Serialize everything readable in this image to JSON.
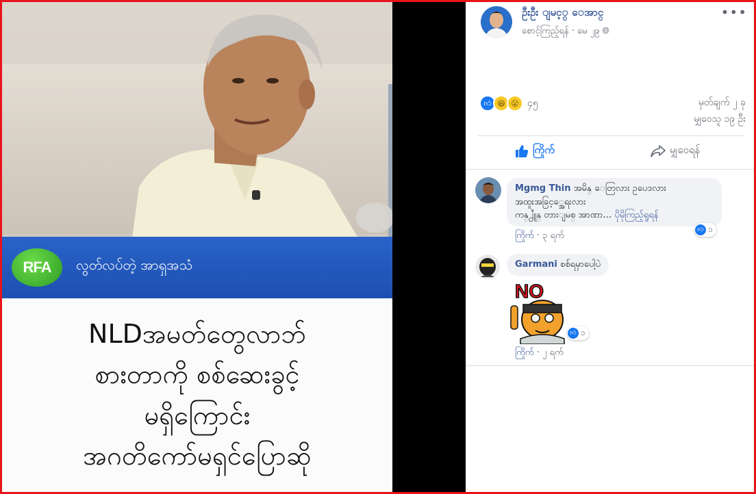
{
  "post_image": {
    "logo_text": "RFA",
    "banner_subtitle": "လွတ်လပ်တဲ့ အာရှအသံ",
    "caption_lines": [
      "NLDအမတ်တွေလာဘ်",
      "စားတာကို စစ်ဆေးခွင့်",
      "မရှိကြောင်း",
      "အဂတိကော်မရှင်ပြောဆို"
    ]
  },
  "post": {
    "author": "ဦးဦး ျမင့္ ေအာင္",
    "visibility_label": "စောင့်ကြည့်ရန်",
    "time": "မေ ၂၉",
    "more_label": "•••"
  },
  "reactions": {
    "count": "၄၅",
    "comments_label": "မှတ်ချက် ၂ ခု",
    "shares_label": "မျှဝေသူ ၁၉ ဦး"
  },
  "actions": {
    "like_label": "ကြိုက်",
    "share_label": "မျှဝေရန်"
  },
  "comments": [
    {
      "name": "Mgmg Thin",
      "lines": [
        "အမိန္ ေတြလား ဥပေဒလား",
        "အထူးအခြင့္အေရးလား",
        "ကန္႕ႆူန္ တားျမစ္ အာဏာ…"
      ],
      "see_more": "ပိုမိုကြည့်ရှုရန်",
      "like_label": "ကြိုက်",
      "time": "၃ ရက်",
      "reaction_count": "၁"
    },
    {
      "name": "Garmani",
      "text": "စစ်ရမှာပေါ့ပဲ",
      "sticker_text": "NO",
      "like_label": "ကြိုက်",
      "time": "၂ ရက်",
      "reaction_count": "၁"
    }
  ],
  "colors": {
    "frame": "#e8141c",
    "facebook_blue": "#1877f2",
    "link_blue": "#385898",
    "rfa_blue": "#1d4fb0",
    "rfa_green": "#2e9b22"
  }
}
